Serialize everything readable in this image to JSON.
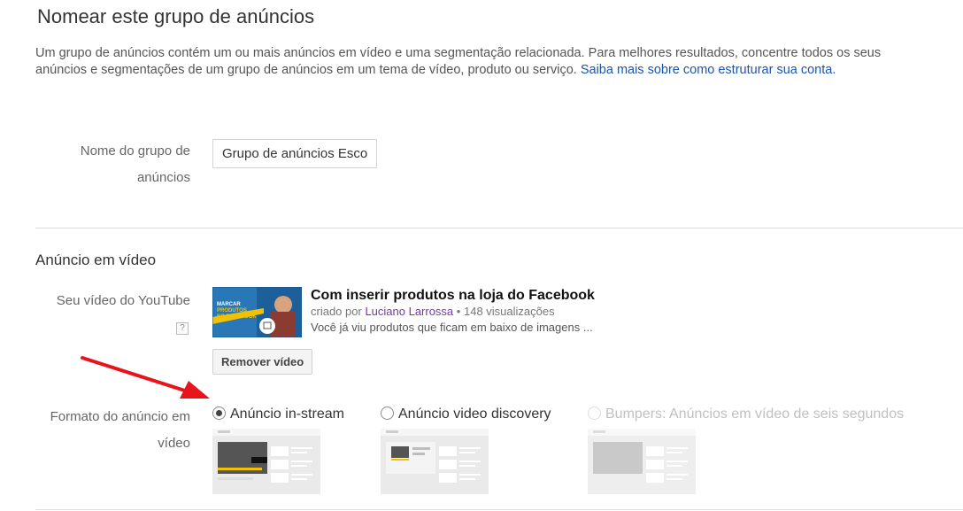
{
  "header": {
    "title": "Nomear este grupo de anúncios",
    "description": "Um grupo de anúncios contém um ou mais anúncios em vídeo e uma segmentação relacionada. Para melhores resultados, concentre todos os seus anúncios e segmentações de um grupo de anúncios em um tema de vídeo, produto ou serviço.",
    "learn_more_link": "Saiba mais sobre como estruturar sua conta."
  },
  "ad_group_name": {
    "label": "Nome do grupo de anúncios",
    "value": "Grupo de anúncios Escola"
  },
  "video_ad": {
    "section_title": "Anúncio em vídeo",
    "youtube_label": "Seu vídeo do YouTube",
    "help_icon": "?",
    "thumbnail_text": [
      "MARCAR",
      "PRODUTOS",
      "NO FACEBOOK"
    ],
    "video_title": "Com inserir produtos na loja do Facebook",
    "created_by_prefix": "criado por",
    "author": "Luciano Larrossa",
    "separator": "•",
    "views": "148 visualizações",
    "snippet": "Você já viu produtos que ficam em baixo de imagens ...",
    "remove_button": "Remover vídeo"
  },
  "format": {
    "label": "Formato do anúncio em vídeo",
    "options": [
      {
        "label": "Anúncio in-stream",
        "selected": true,
        "disabled": false
      },
      {
        "label": "Anúncio video discovery",
        "selected": false,
        "disabled": false
      },
      {
        "label": "Bumpers: Anúncios em vídeo de seis segundos",
        "selected": false,
        "disabled": true
      }
    ]
  },
  "colors": {
    "link": "#1a55b0",
    "author": "#6b3da5",
    "annotation_arrow": "#e8141b",
    "thumbnail_bg": "#1d5f9a",
    "accent_yellow": "#f2c200"
  }
}
